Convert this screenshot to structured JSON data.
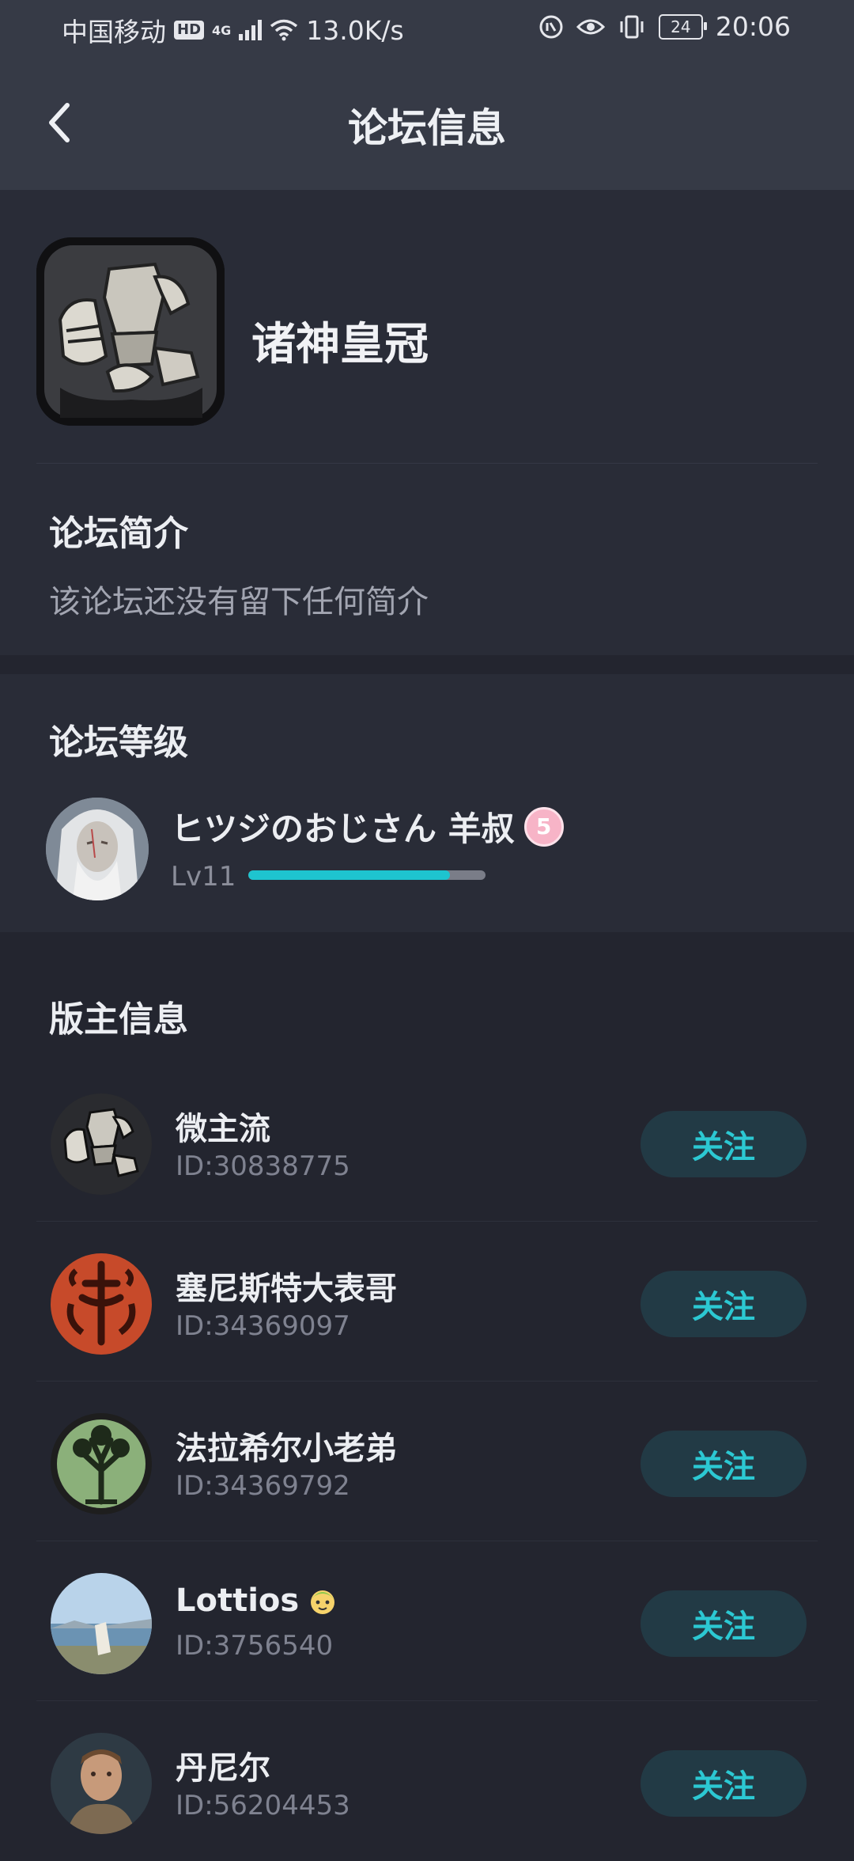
{
  "status_bar": {
    "carrier": "中国移动",
    "hd": "HD",
    "network": "4G",
    "speed": "13.0K/s",
    "battery": "24",
    "time": "20:06"
  },
  "header": {
    "title": "论坛信息",
    "back_icon": "chevron-left-icon"
  },
  "forum": {
    "name": "诸神皇冠",
    "intro_title": "论坛简介",
    "intro_text": "该论坛还没有留下任何简介"
  },
  "level_section": {
    "title": "论坛等级",
    "user_name": "ヒツジのおじさん 羊叔",
    "badge": "5",
    "level": "Lv11",
    "progress": 0.85
  },
  "moderators": {
    "title": "版主信息",
    "follow_label": "关注",
    "items": [
      {
        "name": "微主流",
        "id": "ID:30838775"
      },
      {
        "name": "塞尼斯特大表哥",
        "id": "ID:34369097"
      },
      {
        "name": "法拉希尔小老弟",
        "id": "ID:34369792"
      },
      {
        "name": "Lottios",
        "id": "ID:3756540"
      },
      {
        "name": "丹尼尔",
        "id": "ID:56204453"
      }
    ]
  },
  "colors": {
    "accent": "#1ec4cf",
    "background": "#23252f",
    "card": "#292c37"
  }
}
